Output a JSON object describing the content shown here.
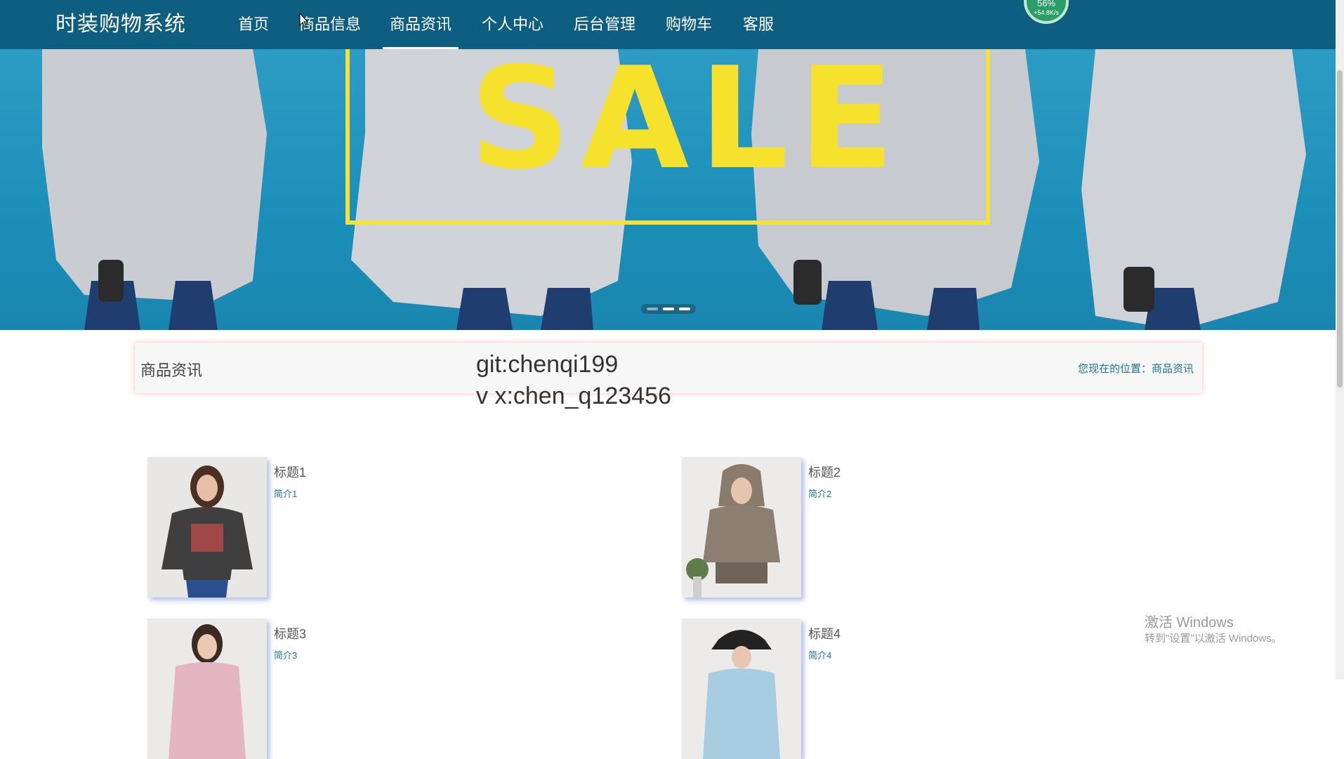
{
  "header": {
    "brand": "时装购物系统",
    "nav": [
      {
        "label": "首页"
      },
      {
        "label": "商品信息"
      },
      {
        "label": "商品资讯"
      },
      {
        "label": "个人中心"
      },
      {
        "label": "后台管理"
      },
      {
        "label": "购物车"
      },
      {
        "label": "客服"
      }
    ],
    "active_index": 2,
    "speed_widget": {
      "percent": "56%",
      "rate": "+54.8K/s"
    }
  },
  "banner": {
    "text": "SALE",
    "slides_count": 3,
    "colors": {
      "background": "#1b8fb9",
      "accent": "#f6e12c"
    }
  },
  "section": {
    "title": "商品资讯",
    "breadcrumb_prefix": "您现在的位置：",
    "breadcrumb_current": "商品资讯"
  },
  "overlay": {
    "line1": "git:chenqi199",
    "line2": "v x:chen_q123456"
  },
  "news": [
    {
      "title": "标题1",
      "summary": "简介1"
    },
    {
      "title": "标题2",
      "summary": "简介2"
    },
    {
      "title": "标题3",
      "summary": "简介3"
    },
    {
      "title": "标题4",
      "summary": "简介4"
    }
  ],
  "windows_activation": {
    "title": "激活 Windows",
    "subtitle": "转到\"设置\"以激活 Windows。"
  },
  "colors": {
    "navbar": "#0e5e82",
    "link": "#1d7399"
  }
}
